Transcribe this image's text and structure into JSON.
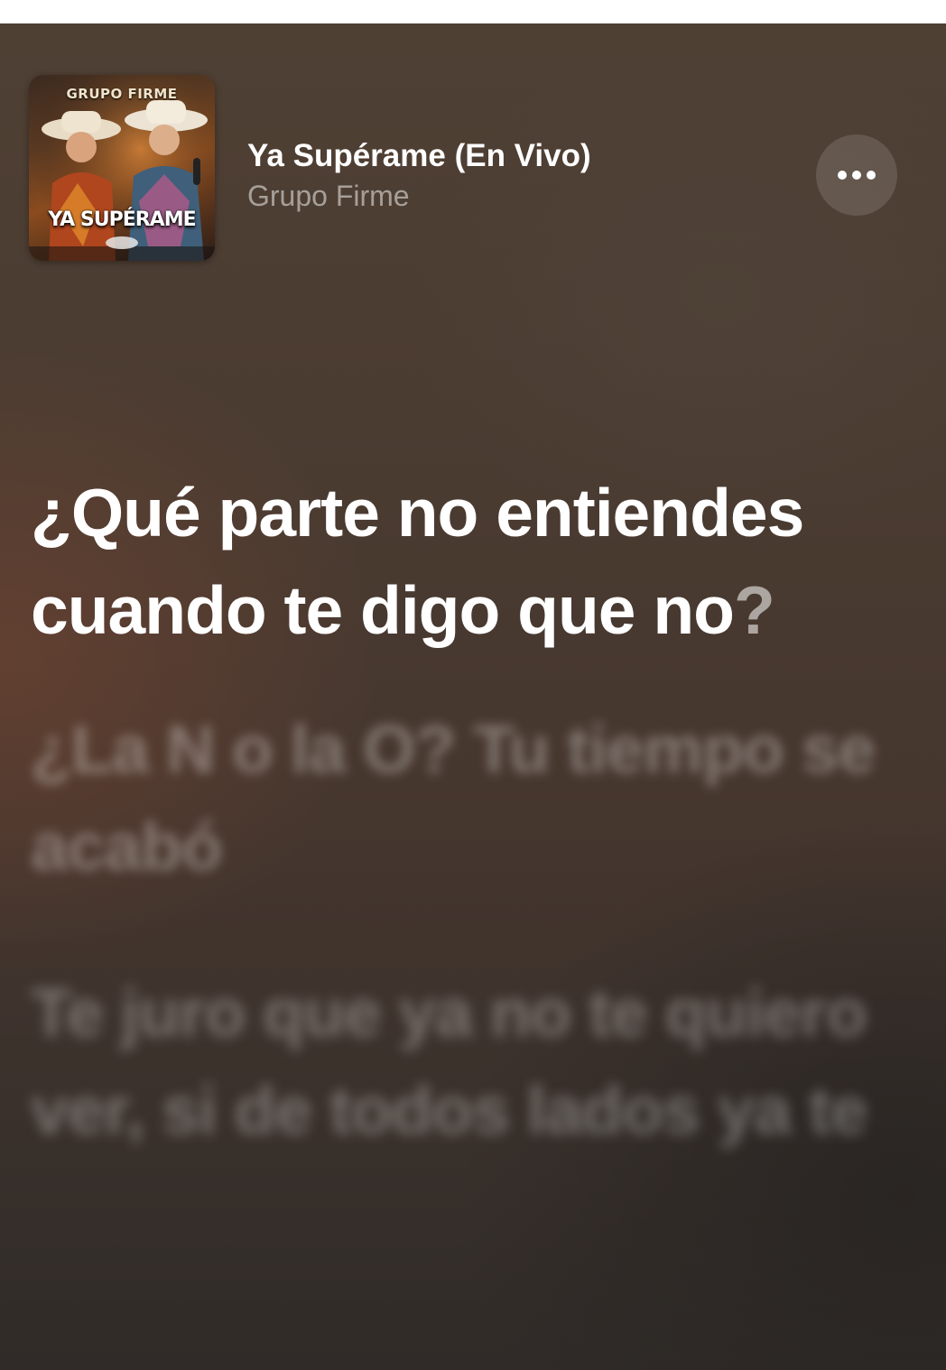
{
  "now_playing": {
    "title": "Ya Supérame (En Vivo)",
    "artist": "Grupo Firme",
    "album_art": {
      "top_text": "GRUPO FIRME",
      "bottom_text": "YA SUPÉRAME"
    },
    "more_icon": "ellipsis-icon"
  },
  "lyrics": {
    "active": {
      "sung": "¿Qué parte no entiendes cuando te digo que no",
      "pending": "?"
    },
    "next": "¿La N o la O? Tu tiempo se acabó",
    "later": "Te juro que ya no te quiero ver, si de todos lados ya te"
  },
  "colors": {
    "background_top": "#4f4034",
    "background_bottom": "#302b28",
    "text_active": "#ffffff",
    "text_dim": "rgba(255,255,255,0.5)"
  }
}
